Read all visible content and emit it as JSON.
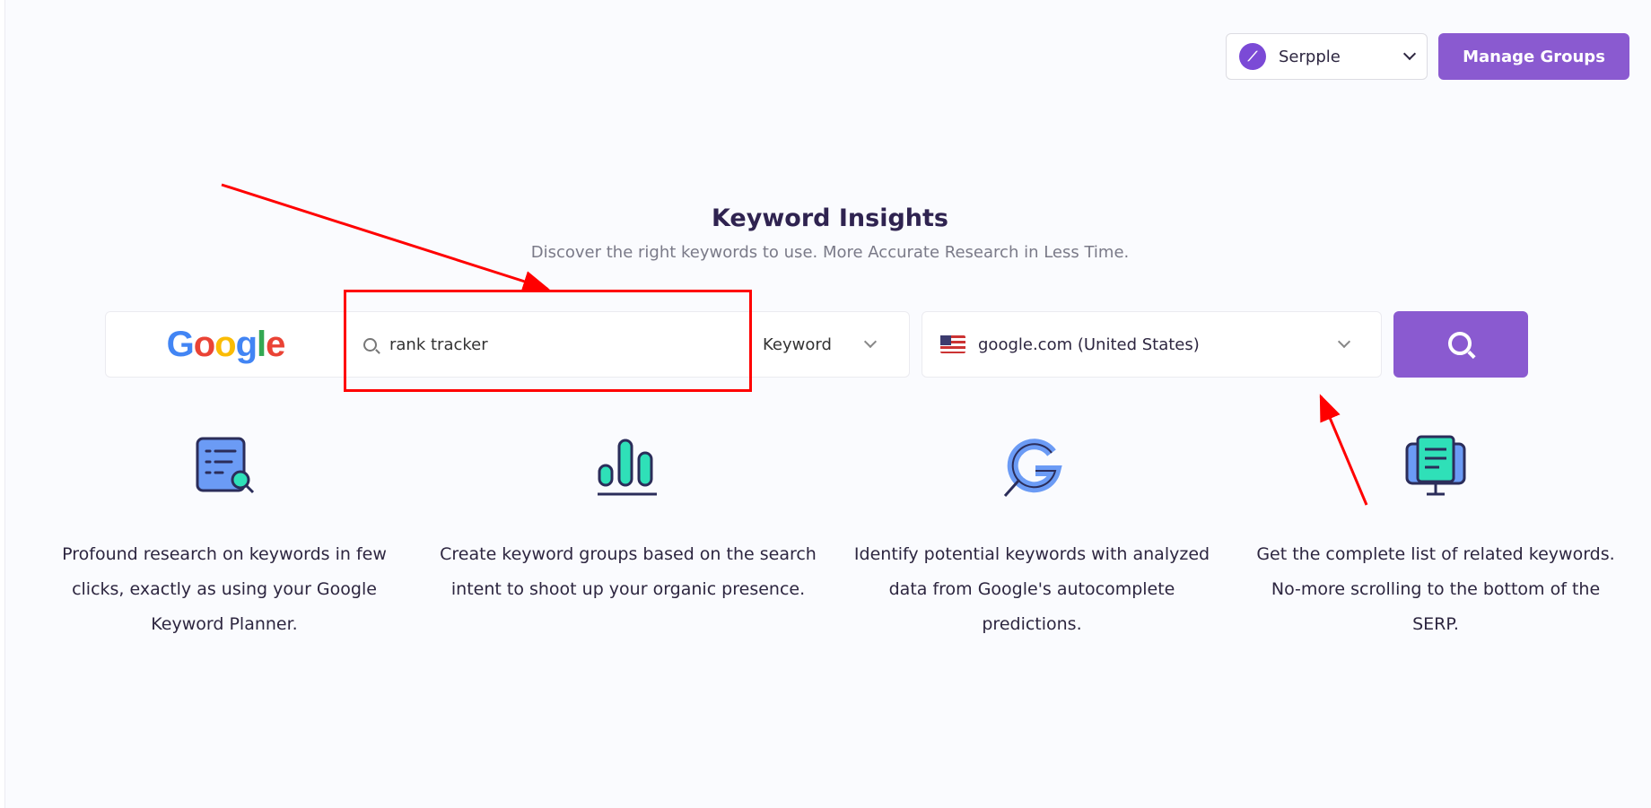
{
  "header": {
    "project_name": "Serpple",
    "manage_groups_label": "Manage Groups"
  },
  "hero": {
    "title": "Keyword Insights",
    "subtitle": "Discover the right keywords to use. More Accurate Research in Less Time."
  },
  "search": {
    "engine": "Google",
    "query": "rank tracker",
    "mode": "Keyword",
    "country": "google.com (United States)"
  },
  "features": [
    {
      "icon": "keyword-list-search-icon",
      "text": "Profound research on keywords in few clicks, exactly as using your Google Keyword Planner."
    },
    {
      "icon": "bar-chart-icon",
      "text": "Create keyword groups based on the search intent to shoot up your organic presence."
    },
    {
      "icon": "google-search-icon",
      "text": "Identify potential keywords with analyzed data from Google's autocomplete predictions."
    },
    {
      "icon": "monitor-document-icon",
      "text": "Get the complete list of related keywords. No-more scrolling to the bottom of the SERP."
    }
  ],
  "colors": {
    "accent": "#8a5ad0",
    "annotation": "#ff0000"
  }
}
